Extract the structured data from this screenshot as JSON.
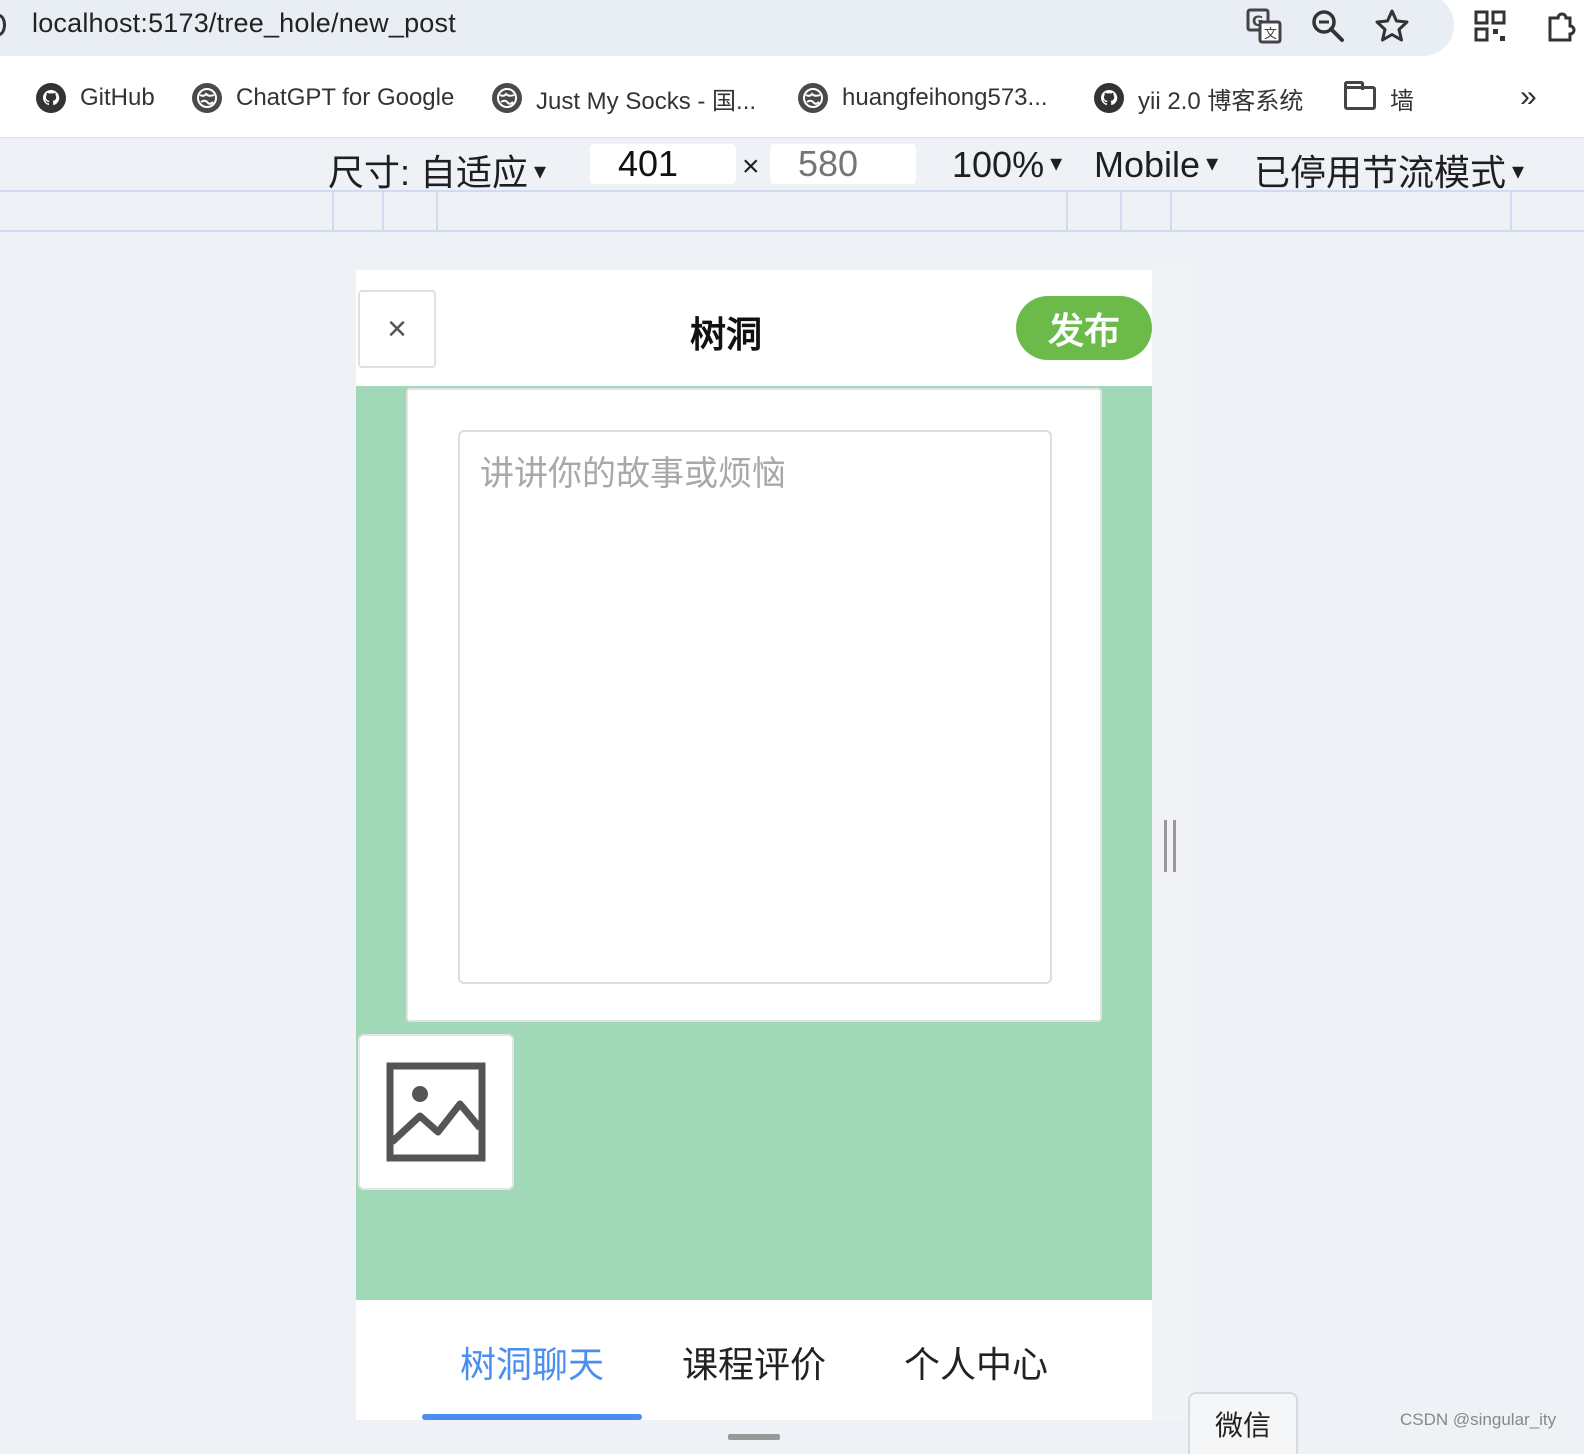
{
  "browser": {
    "url": "localhost:5173/tree_hole/new_post",
    "icons": [
      "translate-icon",
      "zoom-icon",
      "bookmark-star-icon",
      "qr-code-icon",
      "extensions-icon"
    ]
  },
  "bookmarks": {
    "items": [
      {
        "label": "GitHub",
        "icon": "github-icon"
      },
      {
        "label": "ChatGPT for Google",
        "icon": "globe-icon"
      },
      {
        "label": "Just My Socks - 国...",
        "icon": "globe-icon"
      },
      {
        "label": "huangfeihong573...",
        "icon": "globe-icon"
      },
      {
        "label": "yii 2.0 博客系统",
        "icon": "github-icon"
      },
      {
        "label": "墙",
        "icon": "folder-icon"
      }
    ],
    "more": "»"
  },
  "device_toolbar": {
    "size_label": "尺寸: 自适应",
    "width": "401",
    "times": "×",
    "height_placeholder": "580",
    "zoom": "100%",
    "device_type": "Mobile",
    "throttling": "已停用节流模式"
  },
  "app": {
    "close_symbol": "×",
    "title": "树洞",
    "publish_label": "发布",
    "story_placeholder": "讲讲你的故事或烦恼",
    "colors": {
      "background": "#a1d8b7",
      "publish": "#6cbb4a",
      "tab_active": "#4a8ef0"
    },
    "tabs": [
      {
        "label": "树洞聊天",
        "active": true
      },
      {
        "label": "课程评价",
        "active": false
      },
      {
        "label": "个人中心",
        "active": false
      }
    ]
  },
  "taskbar": {
    "wechat_label": "微信"
  },
  "watermark": "CSDN @singular_ity"
}
